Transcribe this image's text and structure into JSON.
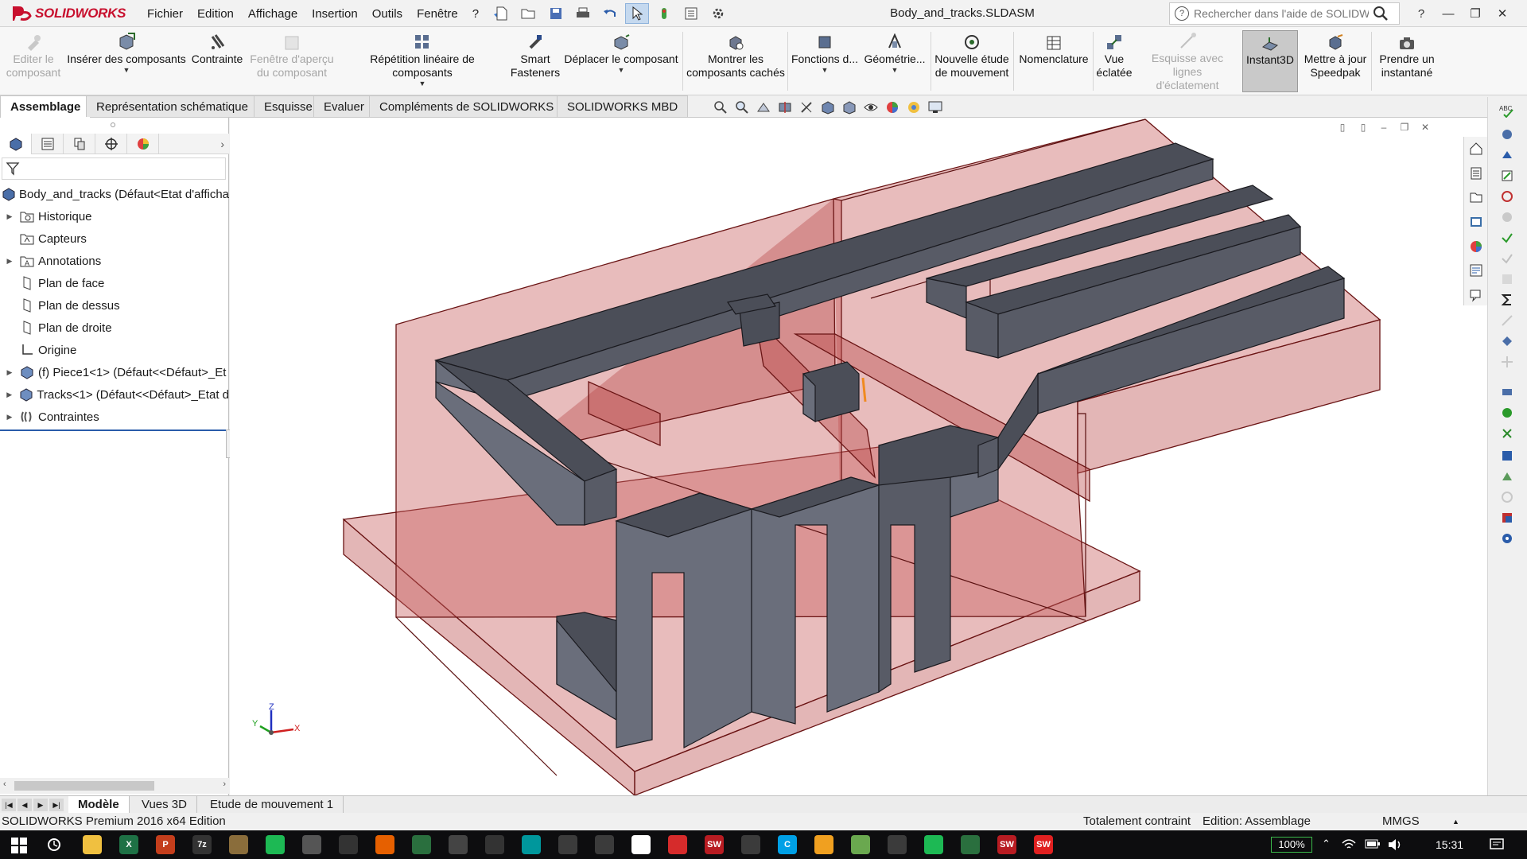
{
  "app": {
    "brand": "SOLIDWORKS",
    "document_title": "Body_and_tracks.SLDASM",
    "menus": [
      "Fichier",
      "Edition",
      "Affichage",
      "Insertion",
      "Outils",
      "Fenêtre",
      "?"
    ],
    "search_placeholder": "Rechercher dans l'aide de SOLIDWORKS",
    "help_label": "?",
    "pin_icon": "pin-icon"
  },
  "ribbon": {
    "buttons": [
      {
        "label1": "Editer le",
        "label2": "composant",
        "disabled": true,
        "icon": "edit-component-icon"
      },
      {
        "label1": "Insérer des composants",
        "label2": "",
        "dropdown": true,
        "icon": "insert-components-icon"
      },
      {
        "label1": "Contrainte",
        "label2": "",
        "icon": "mate-icon"
      },
      {
        "label1": "Fenêtre d'aperçu",
        "label2": "du composant",
        "disabled": true,
        "icon": "preview-window-icon"
      },
      {
        "label1": "Répétition linéaire de composants",
        "label2": "",
        "dropdown": true,
        "icon": "linear-pattern-icon"
      },
      {
        "label1": "Smart",
        "label2": "Fasteners",
        "icon": "smart-fasteners-icon"
      },
      {
        "label1": "Déplacer le composant",
        "label2": "",
        "dropdown": true,
        "icon": "move-component-icon"
      },
      {
        "label1": "Montrer les",
        "label2": "composants cachés",
        "icon": "show-hidden-icon"
      },
      {
        "label1": "Fonctions d...",
        "label2": "",
        "dropdown": true,
        "icon": "assembly-features-icon"
      },
      {
        "label1": "Géométrie...",
        "label2": "",
        "dropdown": true,
        "icon": "reference-geometry-icon"
      },
      {
        "label1": "Nouvelle étude",
        "label2": "de mouvement",
        "icon": "motion-study-icon"
      },
      {
        "label1": "Nomenclature",
        "label2": "",
        "icon": "bom-icon"
      },
      {
        "label1": "Vue",
        "label2": "éclatée",
        "icon": "exploded-view-icon"
      },
      {
        "label1": "Esquisse avec lignes",
        "label2": "d'éclatement",
        "disabled": true,
        "icon": "explode-line-icon"
      },
      {
        "label1": "Instant3D",
        "label2": "",
        "selected": true,
        "icon": "instant3d-icon"
      },
      {
        "label1": "Mettre à jour",
        "label2": "Speedpak",
        "icon": "speedpak-icon"
      },
      {
        "label1": "Prendre un",
        "label2": "instantané",
        "icon": "snapshot-icon"
      }
    ]
  },
  "tabs": [
    "Assemblage",
    "Représentation schématique",
    "Esquisse",
    "Evaluer",
    "Compléments de SOLIDWORKS",
    "SOLIDWORKS MBD"
  ],
  "feature_tree": {
    "root": "Body_and_tracks  (Défaut<Etat d'afficha",
    "items": [
      {
        "label": "Historique",
        "expand": true,
        "icon": "history-icon"
      },
      {
        "label": "Capteurs",
        "expand": false,
        "icon": "sensors-icon"
      },
      {
        "label": "Annotations",
        "expand": true,
        "icon": "annotations-icon"
      },
      {
        "label": "Plan de face",
        "expand": false,
        "icon": "plane-icon"
      },
      {
        "label": "Plan de dessus",
        "expand": false,
        "icon": "plane-icon"
      },
      {
        "label": "Plan de droite",
        "expand": false,
        "icon": "plane-icon"
      },
      {
        "label": "Origine",
        "expand": false,
        "icon": "origin-icon"
      },
      {
        "label": "(f) Piece1<1> (Défaut<<Défaut>_Et",
        "expand": true,
        "icon": "part-icon"
      },
      {
        "label": "Tracks<1> (Défaut<<Défaut>_Etat d",
        "expand": true,
        "icon": "part-icon"
      },
      {
        "label": "Contraintes",
        "expand": true,
        "icon": "mates-icon"
      }
    ]
  },
  "triad": {
    "x": "X",
    "y": "Y",
    "z": "Z"
  },
  "bottom_tabs": [
    "Modèle",
    "Vues 3D",
    "Etude de mouvement 1"
  ],
  "status": {
    "product": "SOLIDWORKS Premium 2016 x64 Edition",
    "constraint": "Totalement contraint",
    "editing": "Edition: Assemblage",
    "units": "MMGS"
  },
  "taskbar": {
    "battery": "100%",
    "time": "15:31",
    "apps": [
      {
        "name": "file-explorer-icon",
        "color": "#f0c040",
        "text": ""
      },
      {
        "name": "excel-icon",
        "color": "#1e7145",
        "text": "X"
      },
      {
        "name": "powerpoint-icon",
        "color": "#c43e1c",
        "text": "P"
      },
      {
        "name": "7zip-icon",
        "color": "#333333",
        "text": "7z"
      },
      {
        "name": "gimp-icon",
        "color": "#8a6d3b",
        "text": ""
      },
      {
        "name": "spotify-icon",
        "color": "#1db954",
        "text": ""
      },
      {
        "name": "solidworks-tool-icon",
        "color": "#555555",
        "text": ""
      },
      {
        "name": "inkscape-icon",
        "color": "#333333",
        "text": ""
      },
      {
        "name": "firefox-icon",
        "color": "#e66000",
        "text": ""
      },
      {
        "name": "kicad-icon",
        "color": "#2a6f3e",
        "text": ""
      },
      {
        "name": "app-icon",
        "color": "#444444",
        "text": ""
      },
      {
        "name": "steam-icon",
        "color": "#333333",
        "text": ""
      },
      {
        "name": "arduino-icon",
        "color": "#00979c",
        "text": ""
      },
      {
        "name": "app-icon",
        "color": "#3b3b3b",
        "text": ""
      },
      {
        "name": "gear-app-icon",
        "color": "#3b3b3b",
        "text": ""
      },
      {
        "name": "app-icon",
        "color": "#ffffff",
        "text": ""
      },
      {
        "name": "foxit-icon",
        "color": "#d62b2b",
        "text": ""
      },
      {
        "name": "solidworks-2016-icon",
        "color": "#b81c22",
        "text": "SW"
      },
      {
        "name": "app-icon",
        "color": "#3b3b3b",
        "text": ""
      },
      {
        "name": "cortana-icon",
        "color": "#00a0e6",
        "text": "C"
      },
      {
        "name": "app-icon",
        "color": "#f0a020",
        "text": ""
      },
      {
        "name": "notepad-icon",
        "color": "#6aa84f",
        "text": ""
      },
      {
        "name": "app-icon",
        "color": "#3b3b3b",
        "text": ""
      },
      {
        "name": "spotify-icon",
        "color": "#1db954",
        "text": ""
      },
      {
        "name": "kicad-icon",
        "color": "#2a6f3e",
        "text": ""
      },
      {
        "name": "solidworks-2016-icon",
        "color": "#b81c22",
        "text": "SW"
      },
      {
        "name": "solidworks-icon",
        "color": "#e02020",
        "text": "SW"
      }
    ]
  },
  "colors": {
    "body_translucent": "#c9605f",
    "track_dark": "#4a4d57",
    "track_side": "#6a6e7a",
    "accent_red": "#c8102e",
    "selection_blue": "#c5d9ef"
  }
}
